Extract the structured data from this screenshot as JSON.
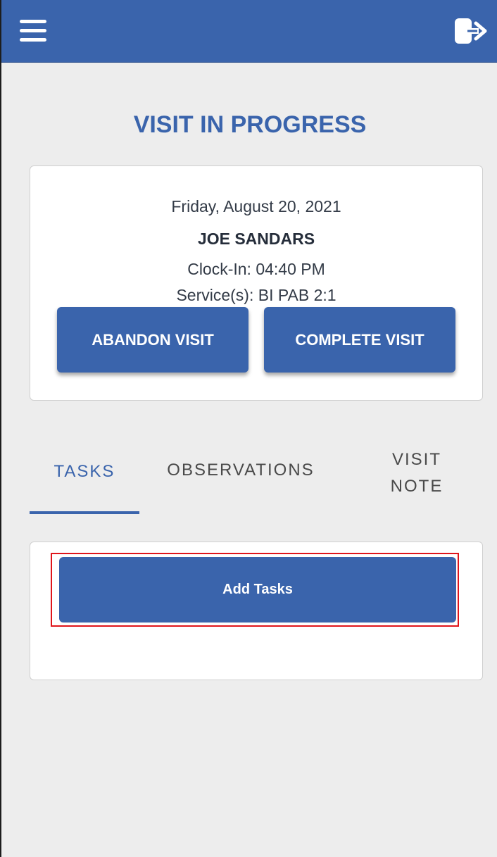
{
  "header": {
    "menu_icon": "hamburger-menu-icon",
    "logout_icon": "logout-icon",
    "bar_color": "#3a64ac"
  },
  "page": {
    "title": "VISIT IN PROGRESS"
  },
  "visit": {
    "date": "Friday, August 20, 2021",
    "client_name": "JOE SANDARS",
    "clock_in": "Clock-In: 04:40 PM",
    "services": "Service(s): BI PAB 2:1",
    "abandon_label": "ABANDON VISIT",
    "complete_label": "COMPLETE VISIT"
  },
  "tabs": [
    {
      "label": "TASKS",
      "active": true
    },
    {
      "label": "OBSERVATIONS",
      "active": false
    },
    {
      "label": "VISIT NOTE",
      "active": false
    }
  ],
  "tasks": {
    "add_label": "Add Tasks",
    "highlight_color": "#e0151b"
  }
}
